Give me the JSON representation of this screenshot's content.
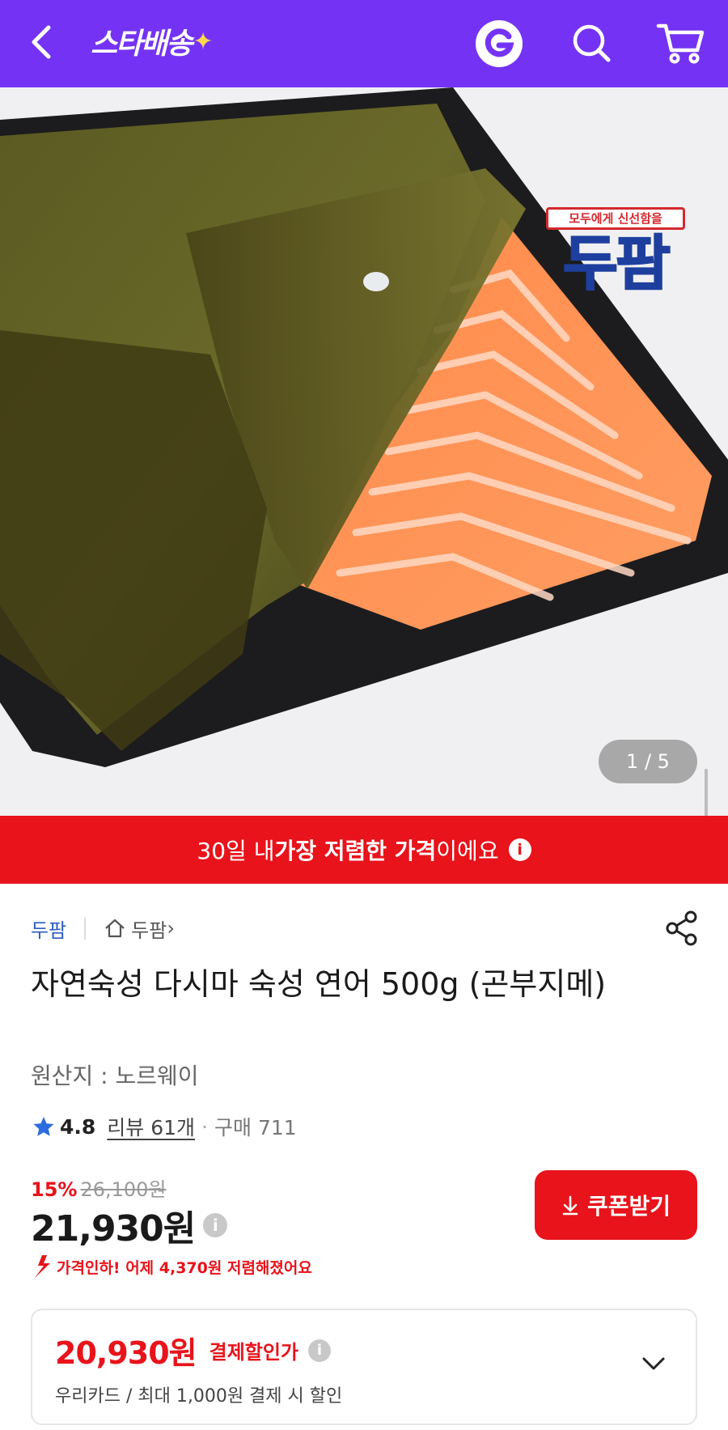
{
  "header": {
    "logo_text": "스타배송",
    "logo_spark": "✦",
    "g_label": "G",
    "brand_color": "#7433f4"
  },
  "hero": {
    "badge_tag": "모두에게 신선함을",
    "badge_brand": "두팜",
    "page_indicator": "1 / 5"
  },
  "banner": {
    "prefix": "30일 내 ",
    "highlight": "가장 저렴한 가격",
    "suffix": "이에요",
    "info_icon": "i",
    "color": "#e8131b"
  },
  "seller": {
    "name": "두팜",
    "store_link": "두팜",
    "store_chevron": "›"
  },
  "product": {
    "title": "자연숙성 다시마 숙성 연어 500g (곤부지메)",
    "origin": "원산지 : 노르웨이"
  },
  "rating": {
    "score": "4.8",
    "reviews": "리뷰 61개",
    "separator": "·",
    "purchases": "구매 711"
  },
  "pricing": {
    "discount_rate": "15%",
    "original_price": "26,100원",
    "price": "21,930원",
    "price_info_icon": "i",
    "coupon_button": "쿠폰받기",
    "price_drop_notice": "가격인하! 어제 4,370원 저렴해졌어요"
  },
  "card_discount": {
    "price": "20,930원",
    "label": "결제할인가",
    "info_icon": "i",
    "description": "우리카드 / 최대 1,000원 결제 시 할인"
  }
}
